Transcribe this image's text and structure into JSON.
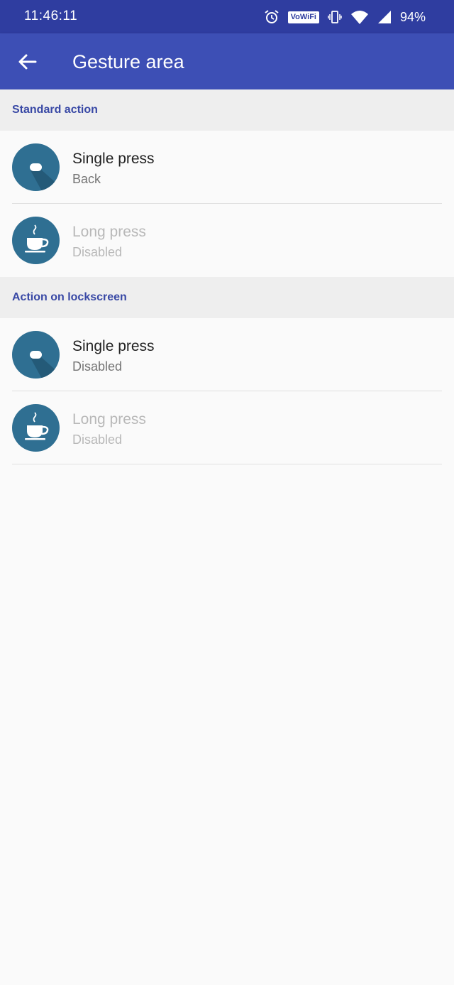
{
  "status_bar": {
    "time": "11:46:11",
    "vowifi_label": "VoWiFi",
    "battery": "94%",
    "icons": [
      "alarm-icon",
      "vowifi-icon",
      "vibrate-icon",
      "wifi-icon",
      "signal-icon"
    ]
  },
  "app_bar": {
    "back_icon": "arrow-back-icon",
    "title": "Gesture area"
  },
  "sections": [
    {
      "header": "Standard action",
      "items": [
        {
          "title": "Single press",
          "subtitle": "Back",
          "icon": "pill-icon",
          "enabled": true
        },
        {
          "title": "Long press",
          "subtitle": "Disabled",
          "icon": "coffee-cup-icon",
          "enabled": false
        }
      ]
    },
    {
      "header": "Action on lockscreen",
      "items": [
        {
          "title": "Single press",
          "subtitle": "Disabled",
          "icon": "pill-icon",
          "enabled": true
        },
        {
          "title": "Long press",
          "subtitle": "Disabled",
          "icon": "coffee-cup-icon",
          "enabled": false
        }
      ]
    }
  ],
  "colors": {
    "status_bar": "#2f3da0",
    "app_bar": "#3d4fb5",
    "section_header_text": "#3848a5",
    "icon_circle": "#2f6f92"
  }
}
